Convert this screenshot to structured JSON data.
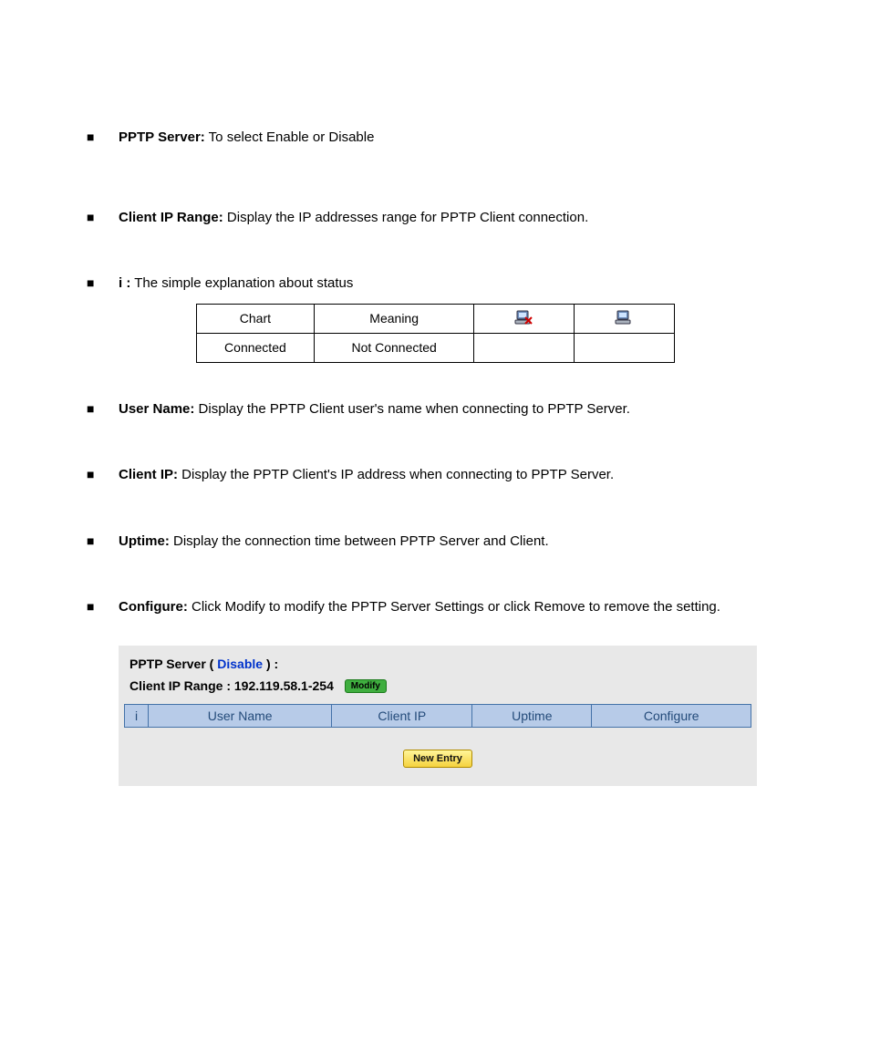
{
  "bullets": [
    {
      "bold": "PPTP Server:",
      "text": " To select Enable or Disable"
    },
    {
      "bold": "Client IP Range:",
      "text": " Display the IP addresses range for PPTP Client connection."
    },
    {
      "bold": "i :",
      "text": " The simple explanation about status"
    },
    {
      "bold": "User Name:",
      "text": " Display the PPTP Client user's name when connecting to PPTP Server."
    },
    {
      "bold": "Client IP:",
      "text": " Display the PPTP Client's IP address when connecting to PPTP Server."
    },
    {
      "bold": "Uptime:",
      "text": " Display the connection time between PPTP Server and Client."
    },
    {
      "bold": "Configure:",
      "text": " Click Modify to modify the PPTP Server Settings or click Remove to remove the setting."
    }
  ],
  "legend": {
    "r1c1": "Chart",
    "r1c2": "Meaning",
    "r2c1": "Connected",
    "r2c2": "Not Connected"
  },
  "panel": {
    "line1_prefix": "PPTP Server ( ",
    "line1_link": "Disable",
    "line1_suffix": " ) :",
    "line2_label": "Client IP Range : ",
    "line2_value": "192.119.58.1-254",
    "modify_label": "Modify",
    "columns": {
      "i": "i",
      "user": "User Name",
      "clientip": "Client IP",
      "uptime": "Uptime",
      "configure": "Configure"
    },
    "new_entry_label": "New Entry"
  }
}
